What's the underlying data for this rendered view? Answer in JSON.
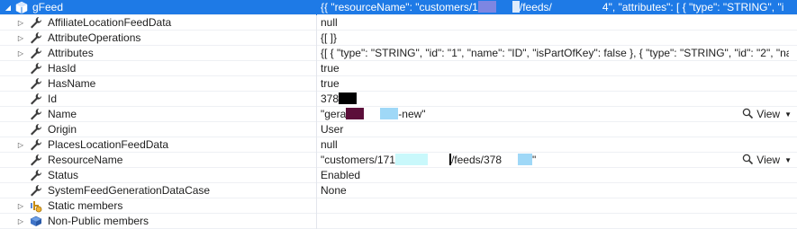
{
  "rows": [
    {
      "name": "gFeed",
      "value_parts": [
        "{{ \"resourceName\": \"customers/1",
        "",
        "/feeds/",
        "4\", \"attributes\": [ { \"type\": \"STRING\", \"i"
      ]
    },
    {
      "name": "AffiliateLocationFeedData",
      "value": "null"
    },
    {
      "name": "AttributeOperations",
      "value": "{[ ]}"
    },
    {
      "name": "Attributes",
      "value": "{[ { \"type\": \"STRING\", \"id\": \"1\", \"name\": \"ID\", \"isPartOfKey\": false }, { \"type\": \"STRING\", \"id\": \"2\", \"na"
    },
    {
      "name": "HasId",
      "value": "true"
    },
    {
      "name": "HasName",
      "value": "true"
    },
    {
      "name": "Id",
      "value": "378"
    },
    {
      "name": "Name",
      "value_parts": [
        "\"gera",
        "-new\""
      ],
      "view_label": "View"
    },
    {
      "name": "Origin",
      "value": "User"
    },
    {
      "name": "PlacesLocationFeedData",
      "value": "null"
    },
    {
      "name": "ResourceName",
      "value_parts": [
        "\"customers/171",
        "/feeds/378",
        "\""
      ],
      "view_label": "View"
    },
    {
      "name": "Status",
      "value": "Enabled"
    },
    {
      "name": "SystemFeedGenerationDataCase",
      "value": "None"
    },
    {
      "name": "Static members",
      "value": ""
    },
    {
      "name": "Non-Public members",
      "value": ""
    }
  ],
  "icons": {
    "root": "object-icon",
    "property": "wrench-icon",
    "static": "static-members-icon",
    "nonpublic": "non-public-members-icon",
    "view": "magnifier-icon"
  },
  "colors": {
    "selection": "#1e7ae6",
    "redact_black": "#000000",
    "redact_maroon": "#5c0f3a",
    "redact_blue": "#9fd8f7",
    "redact_cyan": "#c9f8fb",
    "redact_lavender": "#7d86e2"
  }
}
